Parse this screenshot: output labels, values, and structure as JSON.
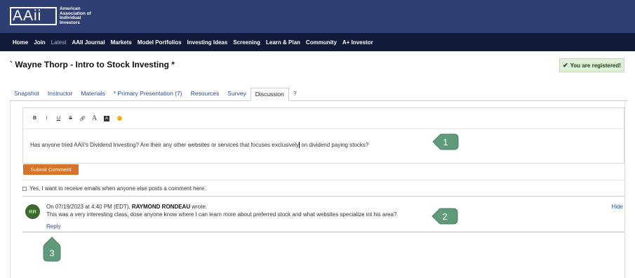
{
  "header": {
    "logo_mark": "AAii",
    "logo_lines": [
      "American",
      "Association of",
      "Individual",
      "Investors"
    ]
  },
  "nav": {
    "items": [
      "Home",
      "Join",
      "Latest",
      "AAII Journal",
      "Markets",
      "Model Portfolios",
      "Investing Ideas",
      "Screening",
      "Learn & Plan",
      "Community",
      "A+ Investor"
    ]
  },
  "page": {
    "title": "` Wayne Thorp - Intro to Stock Investing *",
    "registered_label": "You are registered!"
  },
  "tabs": [
    "Snapshot",
    "Instructor",
    "Materials",
    "* Primary Presentation (7)",
    "Resources",
    "Survey",
    "Discussion",
    "?"
  ],
  "active_tab": "Discussion",
  "editor": {
    "toolbar": [
      "B",
      "I",
      "U",
      "S",
      "link-icon",
      "A",
      "clear-format-icon",
      "emoji-icon"
    ],
    "text_before_caret": "Has anyone tried AAII's Dividend Investing?  Are their any other websites or services that focuses exclusively",
    "text_after_caret": " on dividend paying stocks?"
  },
  "submit_label": "Submit Comment",
  "email_option_label": "Yes, I want to receive emails when anyone else posts a comment here.",
  "comment": {
    "avatar": "RR",
    "meta_prefix": "On 07/19/2023 at 4:40 PM (EDT), ",
    "author": "RAYMOND RONDEAU",
    "meta_suffix": " wrote:",
    "body": "This was a very interesting class, dose anyone know where I can learn more about preferred stock and what websites specialize int his area?",
    "reply_label": "Reply",
    "hide_label": "Hide"
  },
  "callouts": [
    "1",
    "2",
    "3"
  ],
  "colors": {
    "header_bg": "#2f3f73",
    "nav_bg": "#111b39",
    "link": "#2a4d99",
    "submit_bg": "#d8732a",
    "callout_fill": "#5f9a7b",
    "registered_bg": "#dff0d8"
  }
}
